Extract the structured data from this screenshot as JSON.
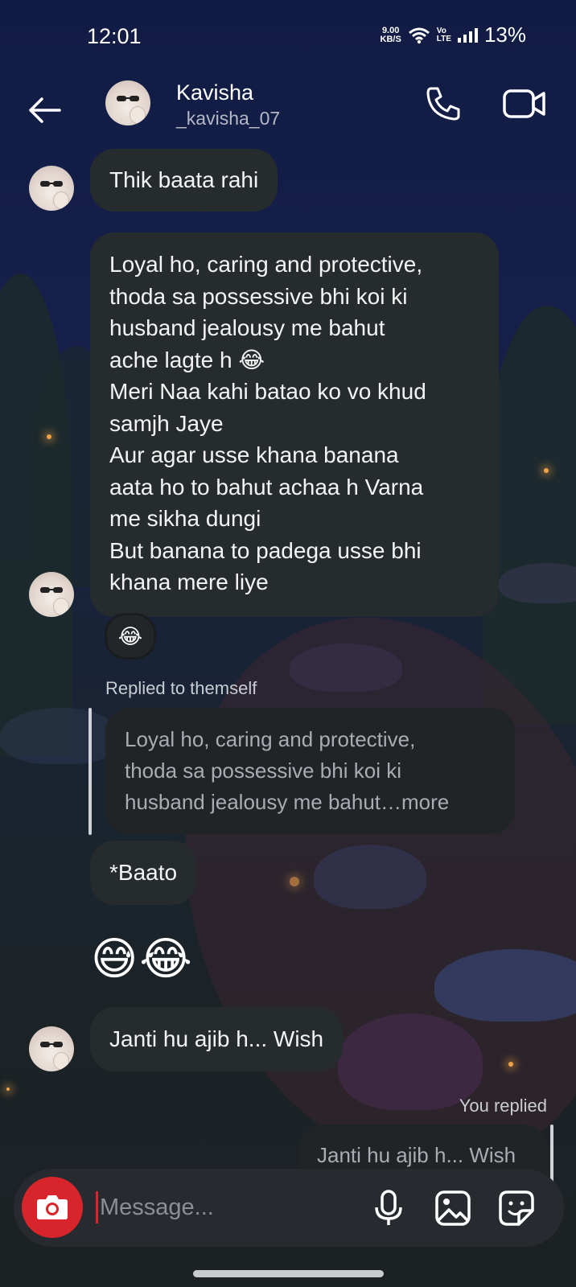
{
  "status_bar": {
    "time": "12:01",
    "net_speed_value": "9.00",
    "net_speed_unit": "KB/S",
    "volte_top": "Vo",
    "volte_bottom": "LTE",
    "battery": "13%"
  },
  "header": {
    "name": "Kavisha",
    "username": "_kavisha_07"
  },
  "messages": [
    {
      "text": "Thik baata rahi"
    },
    {
      "lines": [
        "Loyal ho, caring and protective,",
        "thoda sa possessive bhi koi ki",
        "husband jealousy me bahut",
        "ache lagte h 😂",
        "Meri Naa kahi batao ko vo khud",
        "samjh Jaye",
        "Aur agar usse khana banana",
        "aata ho to bahut achaa h Varna",
        "me sikha dungi",
        "But banana to padega usse bhi",
        "khana mere liye"
      ],
      "reaction": "😂"
    },
    {
      "replied_label": "Replied to themself",
      "quote_lines": [
        "Loyal ho, caring and protective,",
        "thoda sa possessive bhi koi ki",
        "husband jealousy me bahut…more"
      ],
      "text": "*Baato"
    },
    {
      "emojis": "😅😂"
    },
    {
      "text": "Janti hu ajib h... Wish"
    },
    {
      "replied_label": "You replied",
      "quote": "Janti hu ajib h... Wish"
    }
  ],
  "composer": {
    "placeholder": "Message..."
  },
  "colors": {
    "bubble": "#262b2e",
    "camera_button": "#d8252b",
    "background_top": "#111c44",
    "background_bottom": "#1c2124"
  },
  "icons": [
    "back-arrow-icon",
    "phone-icon",
    "video-camera-icon",
    "camera-icon",
    "microphone-icon",
    "gallery-icon",
    "sticker-icon",
    "wifi-icon",
    "signal-icon"
  ]
}
